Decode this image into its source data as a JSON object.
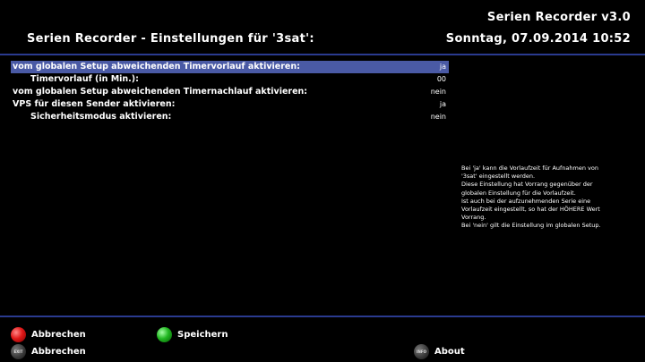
{
  "header": {
    "app_version": "Serien Recorder v3.0",
    "title": "Serien Recorder - Einstellungen für '3sat':",
    "datetime": "Sonntag, 07.09.2014  10:52"
  },
  "settings": [
    {
      "label": "vom globalen Setup abweichenden Timervorlauf aktivieren:",
      "value": "ja",
      "selected": true
    },
    {
      "label": "Timervorlauf (in Min.):",
      "value": "00",
      "indent": true
    },
    {
      "label": "vom globalen Setup abweichenden Timernachlauf aktivieren:",
      "value": "nein"
    },
    {
      "label": "VPS für diesen Sender aktivieren:",
      "value": "ja"
    },
    {
      "label": "Sicherheitsmodus aktivieren:",
      "value": "nein",
      "indent": true
    }
  ],
  "help_lines": [
    "Bei 'ja' kann die Vorlaufzeit für Aufnahmen von",
    "'3sat' eingestellt werden.",
    "Diese Einstellung hat Vorrang gegenüber der",
    "globalen Einstellung für die Vorlaufzeit.",
    "Ist auch bei der aufzunehmenden Serie eine",
    "Vorlaufzeit eingestellt, so hat der HÖHERE Wert",
    "Vorrang.",
    "Bei 'nein' gilt die Einstellung im globalen Setup."
  ],
  "buttons": {
    "red_label": "Abbrechen",
    "green_label": "Speichern",
    "exit_label": "Abbrechen",
    "info_label": "About",
    "exit_key_text": "EXIT",
    "info_key_text": "INFO"
  },
  "colors": {
    "selection": "#4a5aa5",
    "divider": "#2a3a8f",
    "red_key": "#e01818",
    "green_key": "#22b822"
  }
}
